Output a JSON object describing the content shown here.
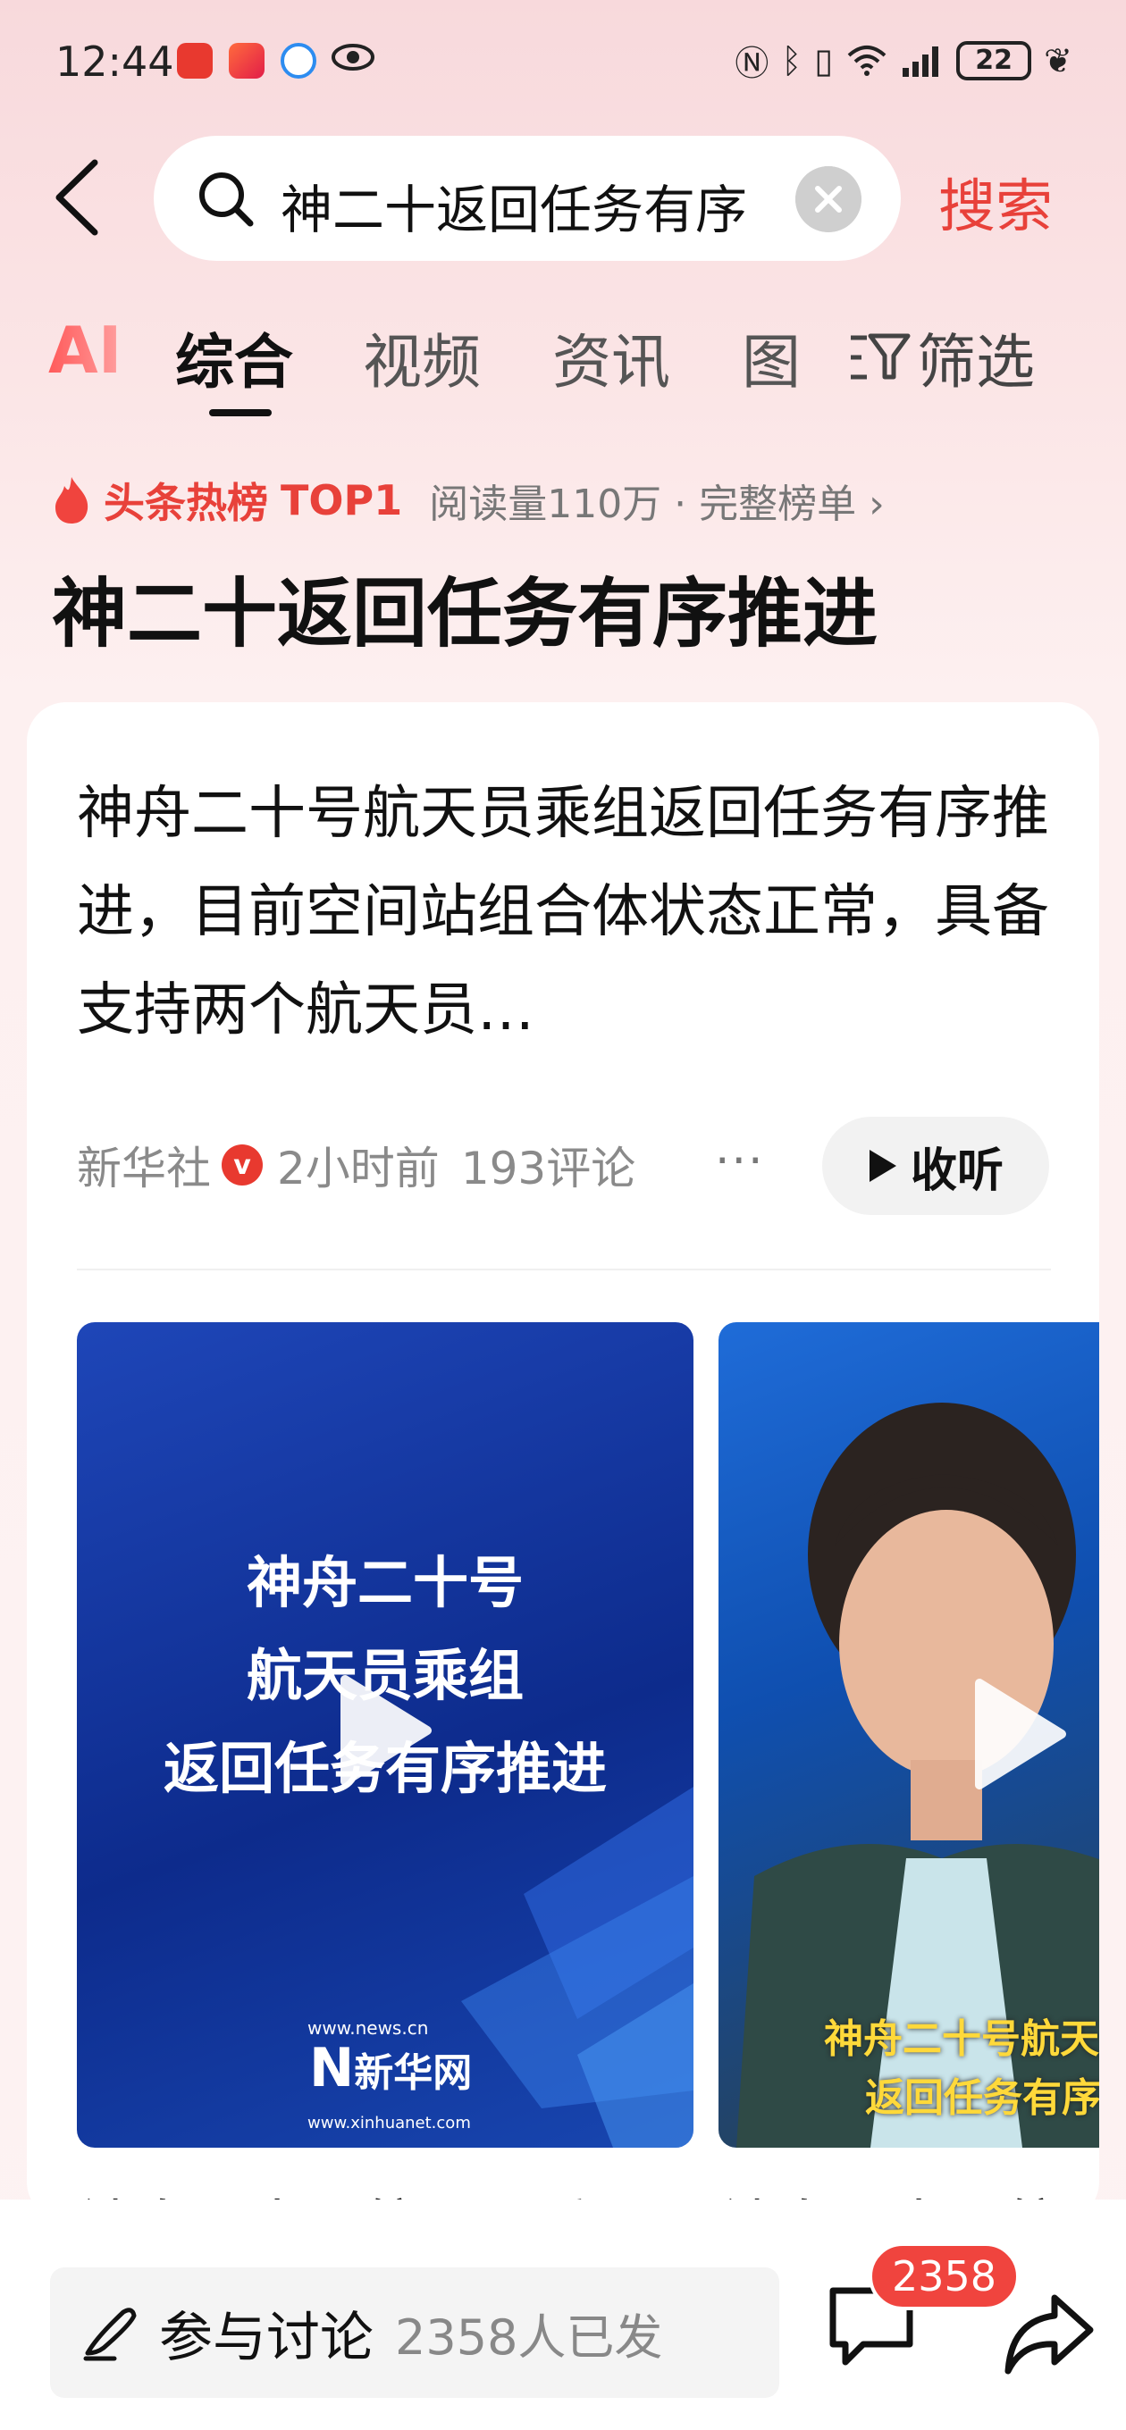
{
  "status_bar": {
    "time": "12:44",
    "battery": "22"
  },
  "search": {
    "query": "神二十返回任务有序推进",
    "submit_label": "搜索"
  },
  "tabs": {
    "ai_label": "AI",
    "items": [
      "综合",
      "视频",
      "资讯",
      "图"
    ],
    "active": "综合",
    "filter_label": "筛选"
  },
  "hot": {
    "label": "头条热榜",
    "rank": "TOP1",
    "meta": "阅读量110万 · 完整榜单 ›",
    "title": "神二十返回任务有序推进"
  },
  "article": {
    "text": "神舟二十号航天员乘组返回任务有序推进，目前空间站组合体状态正常，具备支持两个航天员…",
    "source": "新华社",
    "verified_badge": "v",
    "time": "2小时前",
    "comments": "193评论",
    "more": "···",
    "listen_label": "收听"
  },
  "videos": [
    {
      "overlay_text": [
        "神舟二十号",
        "航天员乘组",
        "返回任务有序推进"
      ],
      "logo_url": "www.news.cn",
      "logo_text": "新华网",
      "logo_url2": "www.xinhuanet.com",
      "title": "神舟二十号航天员乘"
    },
    {
      "caption": [
        "神舟二十号航天",
        "返回任务有序"
      ],
      "title": "神舟二十号航"
    }
  ],
  "bottom": {
    "discuss_label": "参与讨论",
    "discuss_count": "2358人已发",
    "comment_badge": "2358"
  },
  "colors": {
    "accent": "#e8413a",
    "video_blue": "#1e46b8",
    "caption_yellow": "#ffd93a"
  }
}
